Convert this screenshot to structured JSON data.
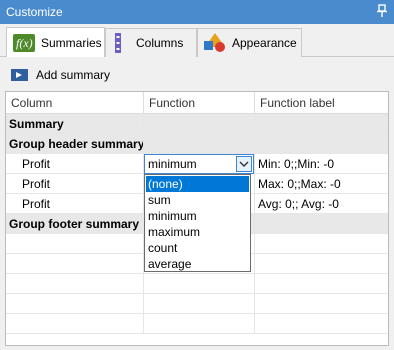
{
  "window": {
    "title": "Customize",
    "pin_icon": "pin-icon"
  },
  "tabs": [
    {
      "label": "Summaries",
      "icon": "fx-icon",
      "active": true
    },
    {
      "label": "Columns",
      "icon": "columns-icon",
      "active": false
    },
    {
      "label": "Appearance",
      "icon": "shapes-icon",
      "active": false
    }
  ],
  "toolbar": {
    "add_summary_label": "Add summary",
    "add_icon": "add-summary-icon"
  },
  "grid": {
    "headers": [
      "Column",
      "Function",
      "Function label"
    ],
    "rows": [
      {
        "type": "group",
        "column": "Summary",
        "function": "",
        "label": ""
      },
      {
        "type": "group",
        "column": "Group header summary",
        "function": "",
        "label": ""
      },
      {
        "type": "item",
        "column": "Profit",
        "function": "minimum",
        "label": "Min: 0;;Min: -0"
      },
      {
        "type": "item",
        "column": "Profit",
        "function": "",
        "label": "Max: 0;;Max: -0"
      },
      {
        "type": "item",
        "column": "Profit",
        "function": "",
        "label": "Avg: 0;; Avg: -0"
      },
      {
        "type": "group",
        "column": "Group footer summary",
        "function": "",
        "label": ""
      }
    ]
  },
  "combo": {
    "value": "minimum"
  },
  "dropdown": {
    "options": [
      "(none)",
      "sum",
      "minimum",
      "maximum",
      "count",
      "average"
    ],
    "selected": "(none)"
  },
  "colors": {
    "titlebar": "#4a8bcd",
    "selection": "#0078d7",
    "group_row": "#e8e8e8"
  }
}
